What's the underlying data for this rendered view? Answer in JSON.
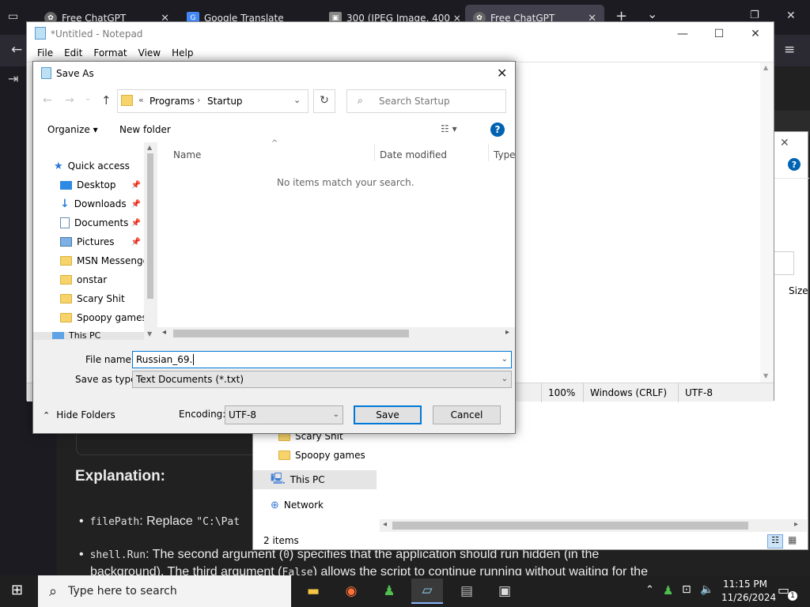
{
  "browser": {
    "tabs": [
      {
        "label": "Free ChatGPT",
        "icon": "chatgpt-icon"
      },
      {
        "label": "Google Translate",
        "icon": "google-translate-icon"
      },
      {
        "label": "300 (JPEG Image, 400 ×",
        "icon": "image-icon"
      },
      {
        "label": "Free ChatGPT",
        "icon": "chatgpt-icon"
      }
    ],
    "new_tab": "+",
    "list_tabs": "⌄",
    "back": "←",
    "menu": "≡"
  },
  "chat": {
    "heading": "Explanation:",
    "bullets": [
      {
        "code": "filePath",
        "text": ": Replace ",
        "code2": "\"C:\\Pat"
      },
      {
        "code": "shell.Run",
        "text": ": The second argument (",
        "code2": "0",
        "text2": ") specifies that the application should run hidden (in the",
        "line2a": "background). The third argument (",
        "code3": "False",
        "line2b": ") allows the script to continue running without waiting for the"
      }
    ]
  },
  "explorer": {
    "tree": [
      "Scary Shit",
      "Spoopy games",
      "This PC",
      "Network"
    ],
    "status_items": "2 items",
    "column_size": "Size"
  },
  "notepad": {
    "title": "*Untitled - Notepad",
    "menu": [
      "File",
      "Edit",
      "Format",
      "View",
      "Help"
    ],
    "status": {
      "zoom": "100%",
      "eol": "Windows (CRLF)",
      "encoding": "UTF-8"
    }
  },
  "save_as": {
    "title": "Save As",
    "breadcrumb": {
      "prefix": "«",
      "parts": [
        "Programs",
        "Startup"
      ]
    },
    "search_placeholder": "Search Startup",
    "organize": "Organize",
    "new_folder": "New folder",
    "help": "?",
    "nav_items": [
      {
        "label": "Quick access",
        "icon": "star-icon",
        "pinned": false
      },
      {
        "label": "Desktop",
        "icon": "desktop-icon",
        "pinned": true
      },
      {
        "label": "Downloads",
        "icon": "download-icon",
        "pinned": true
      },
      {
        "label": "Documents",
        "icon": "documents-icon",
        "pinned": true
      },
      {
        "label": "Pictures",
        "icon": "pictures-icon",
        "pinned": true
      },
      {
        "label": "MSN Messenger",
        "icon": "folder-icon",
        "pinned": false
      },
      {
        "label": "onstar",
        "icon": "folder-icon",
        "pinned": false
      },
      {
        "label": "Scary Shit",
        "icon": "folder-icon",
        "pinned": false
      },
      {
        "label": "Spoopy games",
        "icon": "folder-icon",
        "pinned": false
      },
      {
        "label": "This PC",
        "icon": "computer-icon",
        "pinned": false
      }
    ],
    "columns": [
      "Name",
      "Date modified",
      "Type"
    ],
    "empty_message": "No items match your search.",
    "file_name_label": "File name:",
    "file_name_value": "Russian_69.",
    "save_type_label": "Save as type:",
    "save_type_value": "Text Documents (*.txt)",
    "hide_folders": "Hide Folders",
    "encoding_label": "Encoding:",
    "encoding_value": "UTF-8",
    "save": "Save",
    "cancel": "Cancel"
  },
  "taskbar": {
    "search_placeholder": "Type here to search",
    "time": "11:15 PM",
    "date": "11/26/2024",
    "notifications": "1"
  },
  "colors": {
    "accent": "#0078d7",
    "folder": "#f6d36b"
  }
}
